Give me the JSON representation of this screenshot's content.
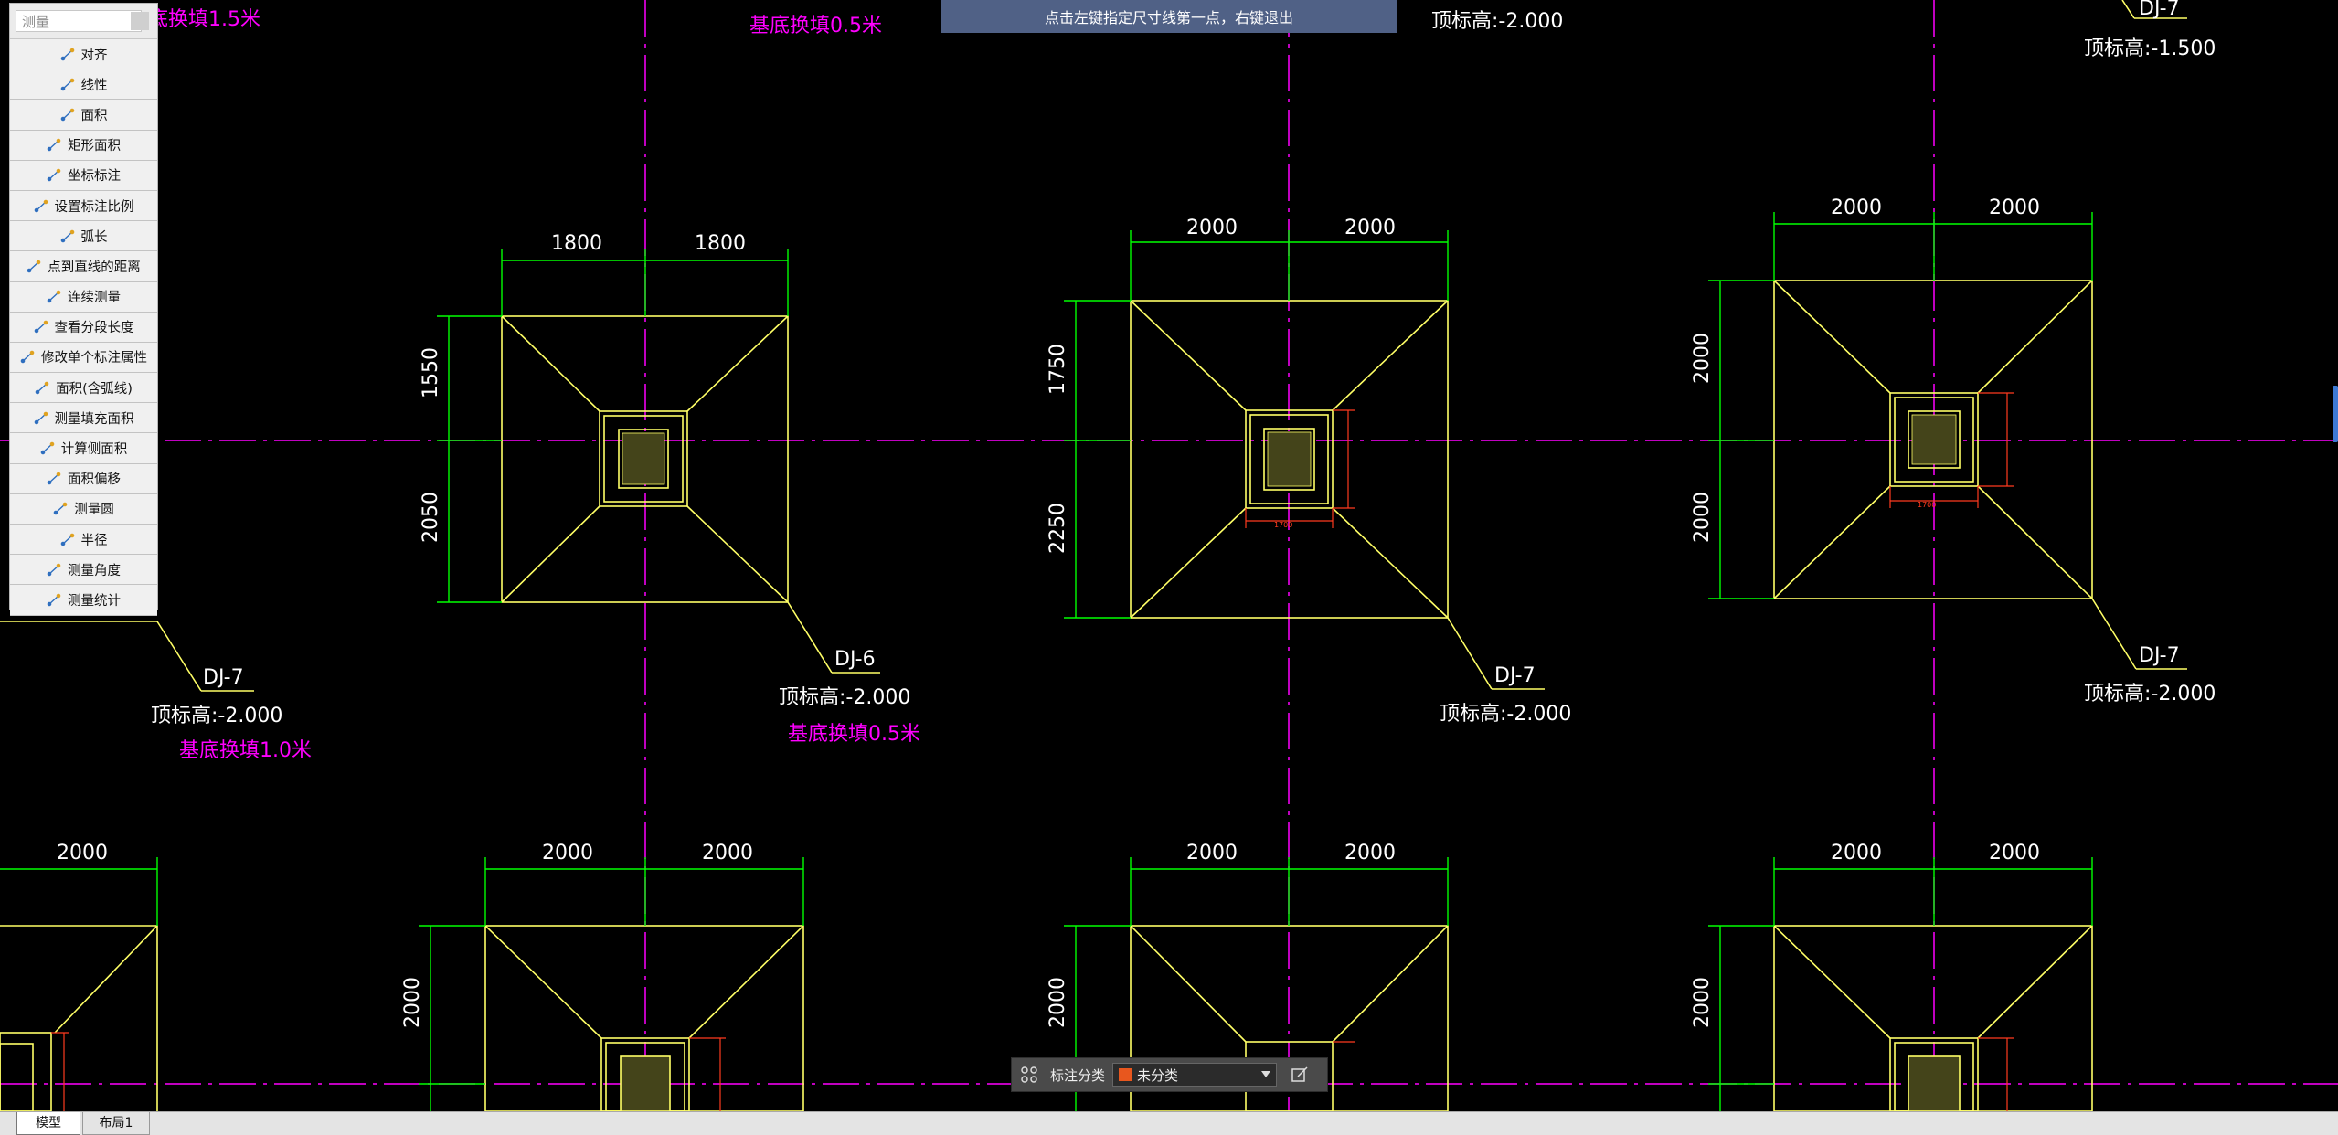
{
  "status_tip": "点击左键指定尺寸线第一点，右键退出",
  "measure_panel": {
    "search_placeholder": "测量",
    "items": [
      {
        "label": "对齐",
        "icon": "align-measure-icon"
      },
      {
        "label": "线性",
        "icon": "linear-measure-icon"
      },
      {
        "label": "面积",
        "icon": "area-icon"
      },
      {
        "label": "矩形面积",
        "icon": "rect-area-icon"
      },
      {
        "label": "坐标标注",
        "icon": "coordinate-icon"
      },
      {
        "label": "设置标注比例",
        "icon": "scale-icon"
      },
      {
        "label": "弧长",
        "icon": "arc-length-icon"
      },
      {
        "label": "点到直线的距离",
        "icon": "point-line-distance-icon"
      },
      {
        "label": "连续测量",
        "icon": "continuous-measure-icon"
      },
      {
        "label": "查看分段长度",
        "icon": "segment-length-icon"
      },
      {
        "label": "修改单个标注属性",
        "icon": "edit-dimension-icon"
      },
      {
        "label": "面积(含弧线)",
        "icon": "arc-area-icon"
      },
      {
        "label": "测量填充面积",
        "icon": "fill-area-icon"
      },
      {
        "label": "计算侧面积",
        "icon": "side-area-icon"
      },
      {
        "label": "面积偏移",
        "icon": "area-offset-icon"
      },
      {
        "label": "测量圆",
        "icon": "circle-measure-icon"
      },
      {
        "label": "半径",
        "icon": "radius-icon"
      },
      {
        "label": "测量角度",
        "icon": "angle-icon"
      },
      {
        "label": "测量统计",
        "icon": "statistics-icon"
      }
    ]
  },
  "annotation_bar": {
    "label": "标注分类",
    "selected": "未分类",
    "swatch_color": "#e8571e"
  },
  "tabs": [
    "模型",
    "布局1"
  ],
  "colors": {
    "background": "#000000",
    "footing": "#ffff66",
    "dimension": "#00ff00",
    "axis": "#ff00ff",
    "rebar": "#ff3b1f",
    "text": "#ffffff"
  },
  "drawing_labels": {
    "top_magenta_1": "底换填1.5米",
    "top_magenta_2": "基底换填0.5米",
    "top_elev_mid": "顶标高:-2.000",
    "top_right_tag": "DJ-7",
    "top_right_elev": "顶标高:-1.500",
    "f1_tag": "DJ-6",
    "f1_elev": "顶标高:-2.000",
    "f1_note": "基底换填0.5米",
    "f1_dims": {
      "left": "1800",
      "right": "1800",
      "top": "1550",
      "bottom": "2050"
    },
    "f2_tag": "DJ-7",
    "f2_elev": "顶标高:-2.000",
    "f2_dims": {
      "left": "2000",
      "right": "2000",
      "top": "1750",
      "bottom": "2250"
    },
    "f3_tag": "DJ-7",
    "f3_elev": "顶标高:-2.000",
    "f3_dims": {
      "left": "2000",
      "right": "2000",
      "top": "2000",
      "bottom": "2000"
    },
    "f0_tag": "DJ-7",
    "f0_elev": "顶标高:-2.000",
    "f0_note": "基底换填1.0米",
    "bottom_row_dim": "2000",
    "small_dim": "1700"
  }
}
